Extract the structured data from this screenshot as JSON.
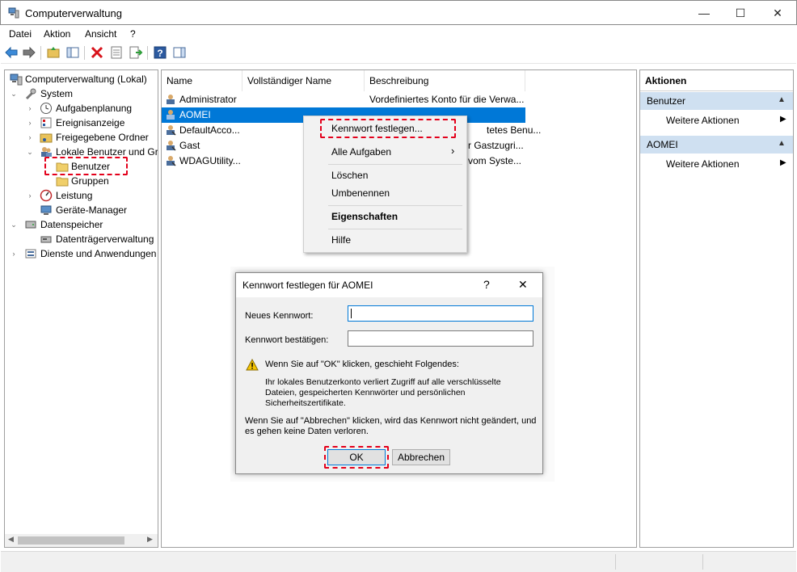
{
  "window": {
    "title": "Computerverwaltung",
    "minimize_glyph": "—",
    "maximize_glyph": "☐",
    "close_glyph": "✕"
  },
  "menu": [
    "Datei",
    "Aktion",
    "Ansicht",
    "?"
  ],
  "toolbar_icons": [
    "back-arrow-icon",
    "forward-arrow-icon",
    "up-folder-icon",
    "show-hide-tree-icon",
    "delete-icon",
    "properties-icon",
    "export-list-icon",
    "help-icon",
    "show-hide-action-pane-icon"
  ],
  "tree": {
    "root": "Computerverwaltung (Lokal)",
    "system": "System",
    "aufgabenplanung": "Aufgabenplanung",
    "ereignisanzeige": "Ereignisanzeige",
    "freigegebene_ordner": "Freigegebene Ordner",
    "lokale_benutzer": "Lokale Benutzer und Gr",
    "benutzer": "Benutzer",
    "gruppen": "Gruppen",
    "leistung": "Leistung",
    "geraete_manager": "Geräte-Manager",
    "datenspeicher": "Datenspeicher",
    "datentraeger": "Datenträgerverwaltung",
    "dienste": "Dienste und Anwendungen"
  },
  "list": {
    "headers": {
      "name": "Name",
      "fullname": "Vollständiger Name",
      "description": "Beschreibung"
    },
    "rows": [
      {
        "name": "Administrator",
        "description": "Vordefiniertes Konto für die Verwa..."
      },
      {
        "name": "AOMEI",
        "description": ""
      },
      {
        "name": "DefaultAcco...",
        "description": "tetes Benu..."
      },
      {
        "name": "Gast",
        "description": "r Gastzugri..."
      },
      {
        "name": "WDAGUtility...",
        "description": "vom Syste..."
      }
    ]
  },
  "context_menu": {
    "set_password": "Kennwort festlegen...",
    "all_tasks": "Alle Aufgaben",
    "all_tasks_arrow": "›",
    "delete": "Löschen",
    "rename": "Umbenennen",
    "properties": "Eigenschaften",
    "help": "Hilfe"
  },
  "actions": {
    "title": "Aktionen",
    "sections": [
      {
        "title": "Benutzer",
        "item": "Weitere Aktionen"
      },
      {
        "title": "AOMEI",
        "item": "Weitere Aktionen"
      }
    ],
    "collapse_glyph": "▲",
    "more_glyph": "▶"
  },
  "dialog": {
    "title": "Kennwort festlegen für AOMEI",
    "help_glyph": "?",
    "close_glyph": "✕",
    "new_password_label": "Neues Kennwort:",
    "confirm_password_label": "Kennwort bestätigen:",
    "warning_line": "Wenn Sie auf \"OK\" klicken, geschieht Folgendes:",
    "info_line1": "Ihr lokales Benutzerkonto verliert Zugriff auf alle verschlüsselte",
    "info_line2": "Dateien, gespeicherten Kennwörter und persönlichen",
    "info_line3": "Sicherheitszertifikate.",
    "cancel_line1": "Wenn Sie auf \"Abbrechen\" klicken, wird das Kennwort nicht geändert, und",
    "cancel_line2": "es gehen keine Daten verloren.",
    "ok": "OK",
    "cancel": "Abbrechen"
  },
  "colors": {
    "selection": "#0078d7",
    "action_header": "#cfe0f1",
    "highlight_dash": "#e3001b"
  }
}
